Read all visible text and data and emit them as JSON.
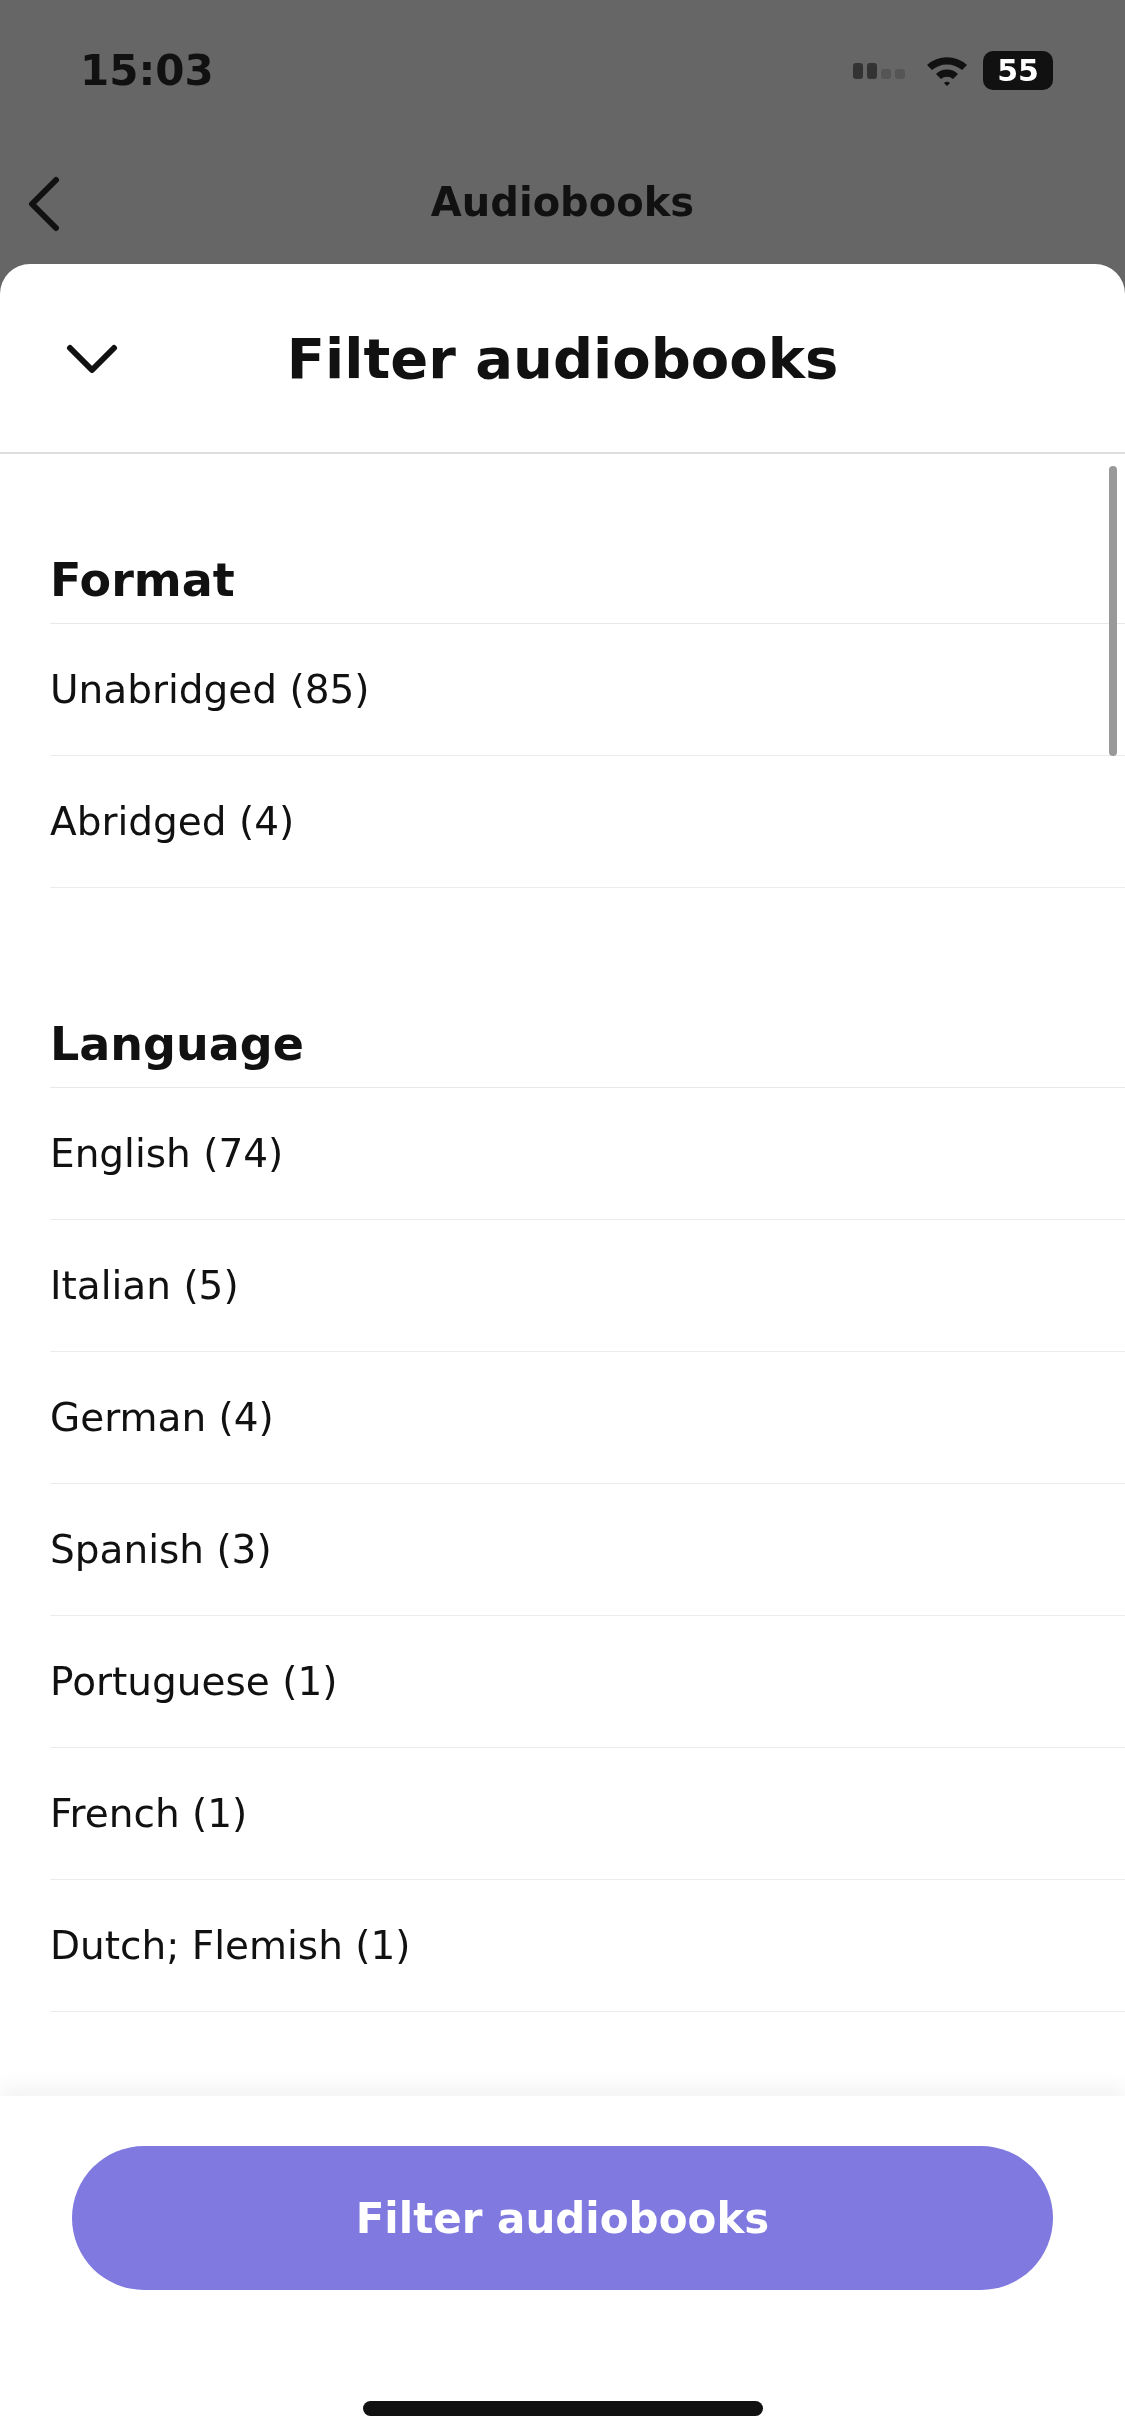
{
  "status_bar": {
    "time": "15:03",
    "battery": "55"
  },
  "nav_bar": {
    "title": "Audiobooks"
  },
  "sheet": {
    "title": "Filter audiobooks",
    "sections": [
      {
        "heading": "Format",
        "options": [
          {
            "label": "Unabridged (85)"
          },
          {
            "label": "Abridged (4)"
          }
        ]
      },
      {
        "heading": "Language",
        "options": [
          {
            "label": "English (74)"
          },
          {
            "label": "Italian (5)"
          },
          {
            "label": "German (4)"
          },
          {
            "label": "Spanish (3)"
          },
          {
            "label": "Portuguese (1)"
          },
          {
            "label": "French (1)"
          },
          {
            "label": "Dutch; Flemish (1)"
          }
        ]
      }
    ],
    "button": "Filter audiobooks"
  }
}
